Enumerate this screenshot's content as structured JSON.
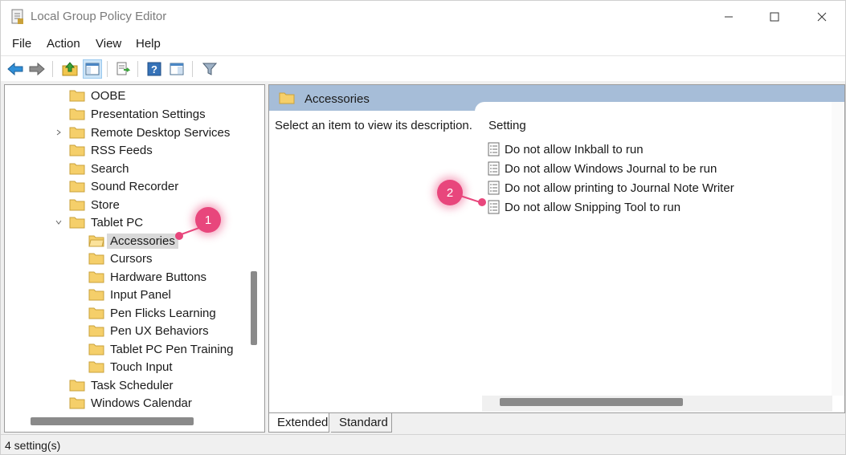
{
  "window": {
    "title": "Local Group Policy Editor"
  },
  "menu": [
    "File",
    "Action",
    "View",
    "Help"
  ],
  "toolbar": {
    "icons": [
      "back-arrow-icon",
      "forward-arrow-icon",
      "up-folder-icon",
      "show-hide-tree-icon",
      "export-list-icon",
      "help-icon",
      "extended-view-icon",
      "filter-icon"
    ]
  },
  "tree": {
    "items": [
      {
        "label": "OOBE"
      },
      {
        "label": "Presentation Settings"
      },
      {
        "label": "Remote Desktop Services"
      },
      {
        "label": "RSS Feeds"
      },
      {
        "label": "Search"
      },
      {
        "label": "Sound Recorder"
      },
      {
        "label": "Store"
      },
      {
        "label": "Tablet PC"
      },
      {
        "label": "Accessories"
      },
      {
        "label": "Cursors"
      },
      {
        "label": "Hardware Buttons"
      },
      {
        "label": "Input Panel"
      },
      {
        "label": "Pen Flicks Learning"
      },
      {
        "label": "Pen UX Behaviors"
      },
      {
        "label": "Tablet PC Pen Training"
      },
      {
        "label": "Touch Input"
      },
      {
        "label": "Task Scheduler"
      },
      {
        "label": "Windows Calendar"
      }
    ]
  },
  "right_pane": {
    "header": "Accessories",
    "description": "Select an item to view its description.",
    "column_header": "Setting",
    "settings": [
      "Do not allow Inkball to run",
      "Do not allow Windows Journal to be run",
      "Do not allow printing to Journal Note Writer",
      "Do not allow Snipping Tool to run"
    ]
  },
  "tabs": [
    "Extended",
    "Standard"
  ],
  "status": "4 setting(s)",
  "annotations": [
    "1",
    "2"
  ],
  "colors": {
    "header_bar": "#a6bdd8",
    "callout": "#e8467c",
    "folder": "#f5cf6a",
    "selection": "#d9d9d9"
  }
}
